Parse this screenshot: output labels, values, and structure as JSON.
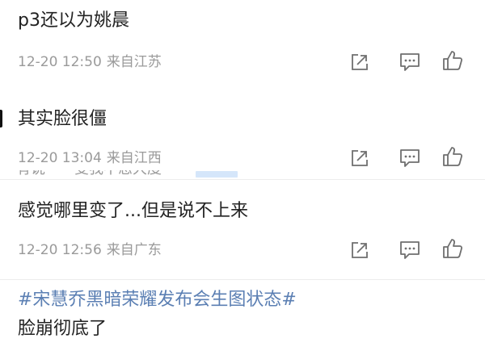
{
  "comments": [
    {
      "text": "p3还以为姚晨",
      "time": "12-20 12:50",
      "location": "来自江苏"
    },
    {
      "text": "其实脸很僵",
      "time": "12-20 13:04",
      "location": "来自江西"
    },
    {
      "text": "感觉哪里变了...但是说不上来",
      "time": "12-20 12:56",
      "location": "来自广东"
    }
  ],
  "partial_comment": "有说一一变我不态大度",
  "post": {
    "hashtag": "#宋慧乔黑暗荣耀发布会生图状态#",
    "text": "脸崩彻底了"
  },
  "colors": {
    "text": "#222222",
    "meta": "#9a9a9a",
    "icon": "#6f6f6f",
    "hashtag": "#5b7fb3",
    "divider": "#ececec"
  },
  "icons": [
    "share-icon",
    "comment-icon",
    "like-icon"
  ]
}
